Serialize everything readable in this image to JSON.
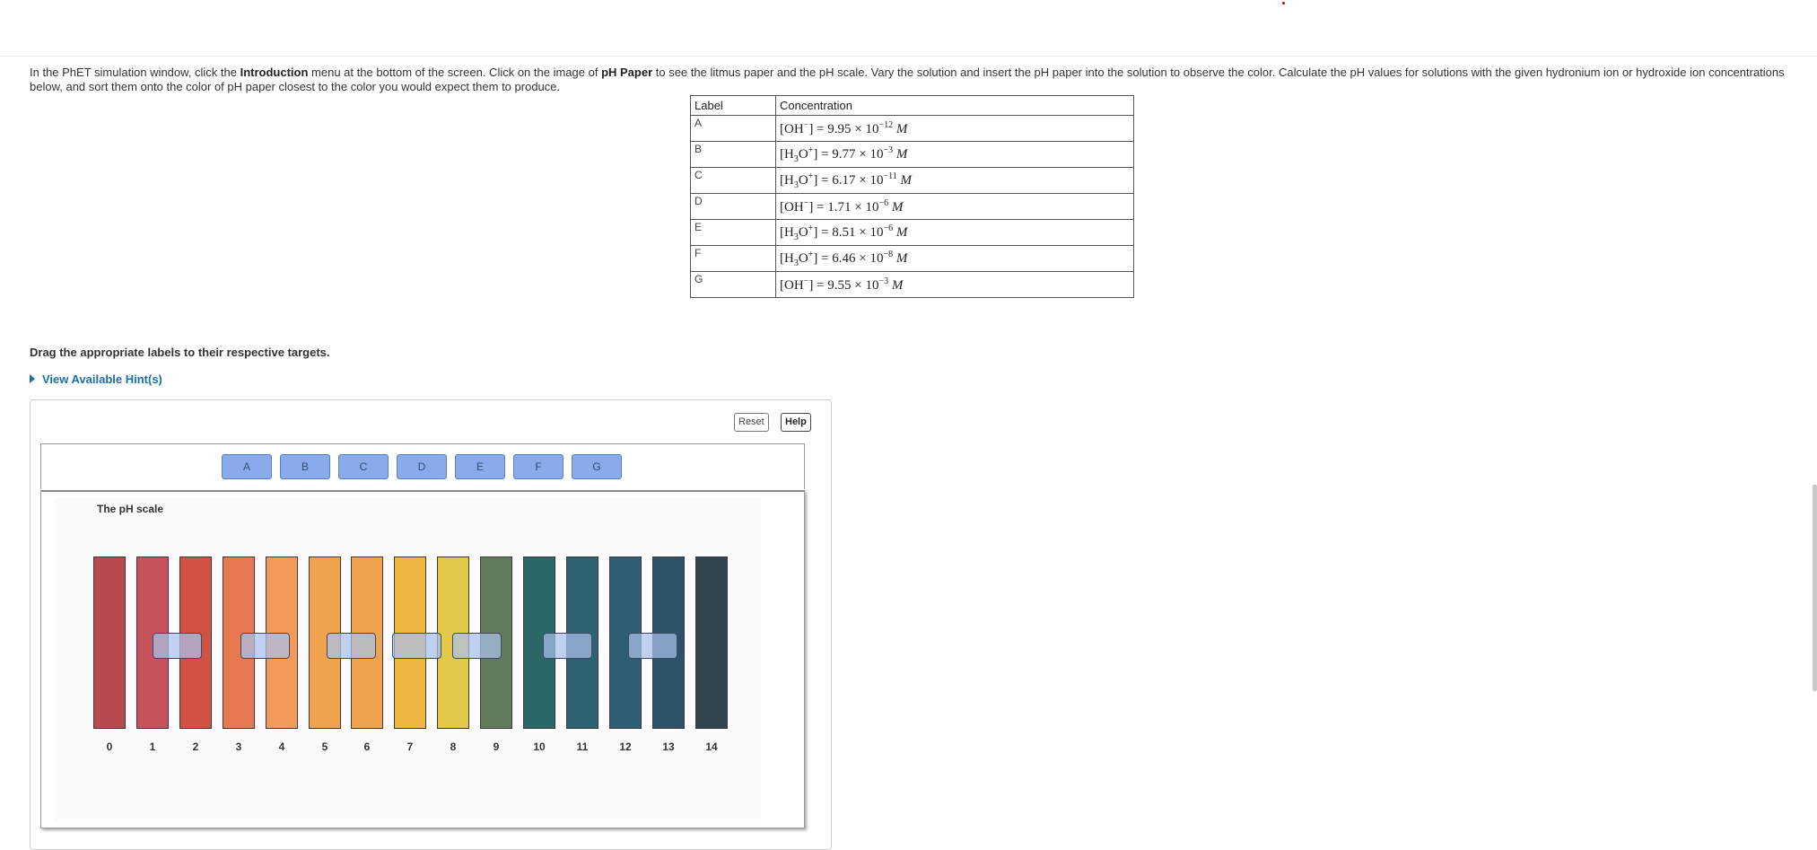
{
  "instructions": {
    "p1": "In the PhET simulation window, click the ",
    "b1": "Introduction",
    "p2": " menu at the bottom of the screen. Click on the image of ",
    "b2": "pH Paper",
    "p3": " to see the litmus paper and the pH scale. Vary the solution and insert the pH paper into the solution to observe the color.  Calculate the pH values for solutions with the given hydronium ion or hydroxide ion concentrations below, and sort them onto the color of pH paper closest to the color you would expect them to produce."
  },
  "table": {
    "headers": [
      "Label",
      "Concentration"
    ],
    "rows": [
      {
        "label": "A",
        "species": "OH",
        "charge": "−",
        "mantissa": "9.95",
        "exp": "−12",
        "unit": "M"
      },
      {
        "label": "B",
        "species": "H3O",
        "charge": "+",
        "mantissa": "9.77",
        "exp": "−3",
        "unit": "M"
      },
      {
        "label": "C",
        "species": "H3O",
        "charge": "+",
        "mantissa": "6.17",
        "exp": "−11",
        "unit": "M"
      },
      {
        "label": "D",
        "species": "OH",
        "charge": "−",
        "mantissa": "1.71",
        "exp": "−6",
        "unit": "M"
      },
      {
        "label": "E",
        "species": "H3O",
        "charge": "+",
        "mantissa": "8.51",
        "exp": "−6",
        "unit": "M"
      },
      {
        "label": "F",
        "species": "H3O",
        "charge": "+",
        "mantissa": "6.46",
        "exp": "−8",
        "unit": "M"
      },
      {
        "label": "G",
        "species": "OH",
        "charge": "−",
        "mantissa": "9.55",
        "exp": "−3",
        "unit": "M"
      }
    ]
  },
  "drag_instructions": "Drag the appropriate labels to their respective targets.",
  "hint_link": "View Available Hint(s)",
  "buttons": {
    "reset": "Reset",
    "help": "Help"
  },
  "labels": [
    "A",
    "B",
    "C",
    "D",
    "E",
    "F",
    "G"
  ],
  "ph_scale": {
    "title": "The pH scale",
    "ticks": [
      "0",
      "1",
      "2",
      "3",
      "4",
      "5",
      "6",
      "7",
      "8",
      "9",
      "10",
      "11",
      "12",
      "13",
      "14"
    ],
    "colors": [
      "#b94a4e",
      "#c7525c",
      "#d05245",
      "#e8784f",
      "#f29a5a",
      "#f0a24e",
      "#f0a24e",
      "#f0b642",
      "#e3c84a",
      "#637a5c",
      "#2a6767",
      "#2d6270",
      "#2f5d74",
      "#2d526a",
      "#33464f"
    ],
    "target_positions_ph": [
      "1-2",
      "3-4",
      "5-6",
      "7-8",
      "8-9",
      "10-11",
      "12-13"
    ]
  },
  "colors": {
    "chip_bg": "#8aabeb",
    "chip_border": "#5c7fc2",
    "hint_link": "#1a6fa8",
    "target_bg": "rgba(170,192,235,0.72)"
  }
}
